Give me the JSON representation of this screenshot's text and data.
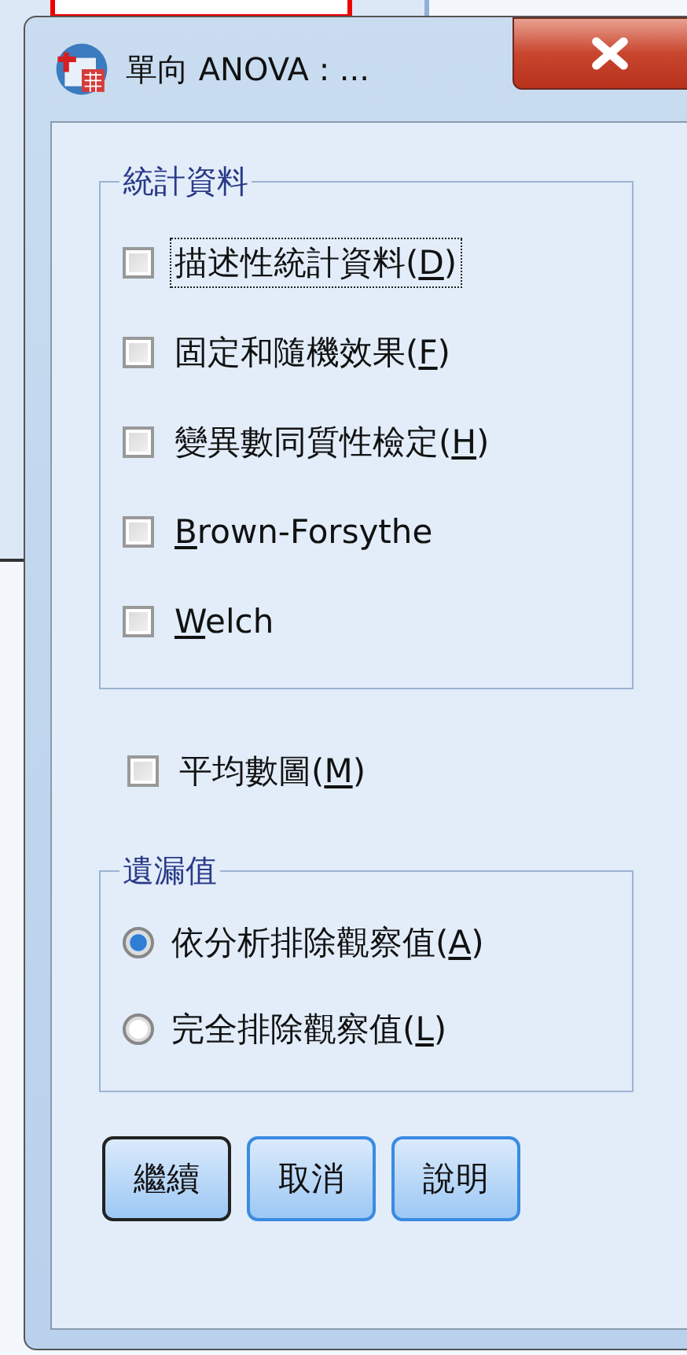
{
  "window": {
    "title": "單向 ANOVA : ..."
  },
  "statistics": {
    "title": "統計資料",
    "items": [
      {
        "text": "描述性統計資料(",
        "access_key": "D",
        "text_end": ")",
        "checked": false,
        "focused": true
      },
      {
        "text": "固定和隨機效果(",
        "access_key": "F",
        "text_end": ")",
        "checked": false,
        "focused": false
      },
      {
        "text": "變異數同質性檢定(",
        "access_key": "H",
        "text_end": ")",
        "checked": false,
        "focused": false
      },
      {
        "access_key": "B",
        "text_end": "rown-Forsythe",
        "checked": false,
        "focused": false
      },
      {
        "access_key": "W",
        "text_end": "elch",
        "checked": false,
        "focused": false
      }
    ]
  },
  "means_plot": {
    "text": "平均數圖(",
    "access_key": "M",
    "text_end": ")",
    "checked": false
  },
  "missing_values": {
    "title": "遺漏值",
    "options": [
      {
        "text": "依分析排除觀察值(",
        "access_key": "A",
        "text_end": ")",
        "selected": true
      },
      {
        "text": "完全排除觀察值(",
        "access_key": "L",
        "text_end": ")",
        "selected": false
      }
    ]
  },
  "buttons": [
    {
      "label": "繼續",
      "default": true
    },
    {
      "label": "取消",
      "default": false
    },
    {
      "label": "說明",
      "default": false
    }
  ]
}
